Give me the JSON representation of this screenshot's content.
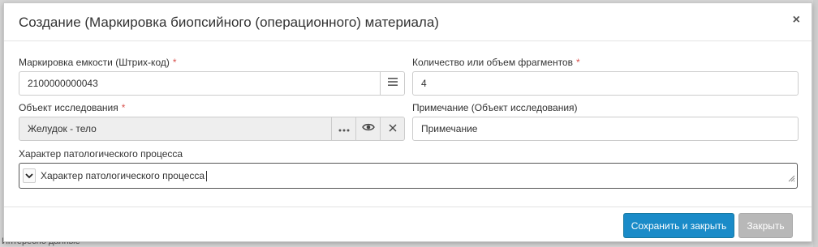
{
  "background": {
    "under_text": "Интересно данные"
  },
  "dialog": {
    "title": "Создание (Маркировка биопсийного (операционного) материала)",
    "close_label": "×"
  },
  "fields": {
    "container_marking": {
      "label": "Маркировка емкости (Штрих-код)",
      "value": "2100000000043",
      "required": "*"
    },
    "fragments_count": {
      "label": "Количество или объем фрагментов",
      "value": "4",
      "required": "*"
    },
    "research_object": {
      "label": "Объект исследования",
      "value": "Желудок - тело",
      "required": "*"
    },
    "note": {
      "label": "Примечание (Объект исследования)",
      "value": "Примечание"
    },
    "pathology_character": {
      "label": "Характер патологического процесса",
      "value": "Характер патологического процесса"
    }
  },
  "footer": {
    "save_close_label": "Сохранить и закрыть",
    "close_label": "Закрыть"
  },
  "colors": {
    "primary": "#1a8bc8",
    "secondary": "#b8b8b8",
    "required": "#d9534f"
  }
}
